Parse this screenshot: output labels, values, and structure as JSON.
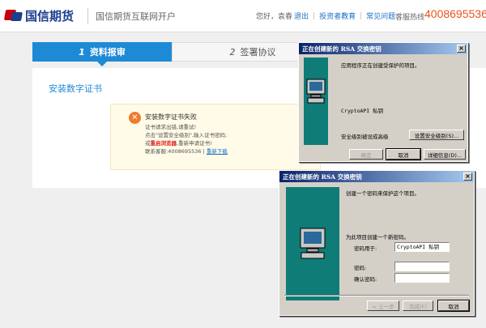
{
  "header": {
    "logo_text": "国信期货",
    "site_title": "国信期货互联网开户",
    "greeting": "您好，袁春",
    "logout": "退出",
    "links": [
      "投资者教育",
      "常见问题"
    ],
    "hotline_label": "客服热线",
    "hotline_number": "4008695536"
  },
  "steps": [
    {
      "num": "1",
      "label": "资料报审"
    },
    {
      "num": "2",
      "label": "签署协议"
    }
  ],
  "panel": {
    "title": "安装数字证书",
    "error": {
      "title": "安装数字证书失败",
      "line1": "证书请求出错,请重试!",
      "line2": "点击\"设置安全级别\",输入证书密码;",
      "line3_prefix": "或",
      "line3_red": "重启浏览器",
      "line3_suffix": ",重新申请证书!",
      "line4_prefix": "联系客服:4008695536 |",
      "line4_link": "重新下载"
    }
  },
  "dialog1": {
    "title": "正在创建新的 RSA 交换密钥",
    "message": "应用程序正在创建受保护的项目。",
    "key_name": "CryptoAPI 私钥",
    "security_label": "安全级别被设成高级",
    "set_security_button": "设置安全级别(S)...",
    "ok_button": "确定",
    "cancel_button": "取消",
    "details_button": "详细信息(D)..."
  },
  "dialog2": {
    "title": "正在创建新的 RSA 交换密钥",
    "intro": "创建一个密码来保护这个项目。",
    "for_item_label": "为此项目创建一个新密码。",
    "password_for_label": "密码用于:",
    "password_for_value": "CryptoAPI 私钥",
    "password_label": "密码:",
    "confirm_label": "确认密码:",
    "back_button": "< 上一步",
    "finish_button": "完成(F)",
    "cancel_button": "取消"
  },
  "colors": {
    "brand_blue": "#1e8ad6",
    "hotline_orange": "#e8541c",
    "error_orange": "#f07a2e",
    "dialog_teal": "#0f7c77"
  }
}
